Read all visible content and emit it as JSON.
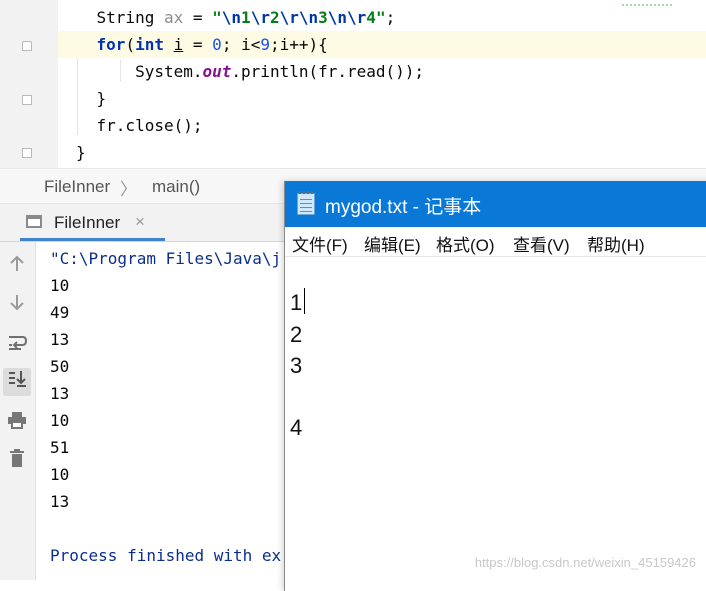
{
  "editor": {
    "line1": {
      "indent": "    ",
      "type": "String",
      "var": "ax",
      "op": " = ",
      "q1": "\"",
      "e1": "\\n",
      "v1": "1",
      "e2": "\\r",
      "v2": "2",
      "e3": "\\r",
      "e4": "\\n",
      "v3": "3",
      "e5": "\\n",
      "e6": "\\r",
      "v4": "4",
      "q2": "\"",
      "end": ";"
    },
    "line2": {
      "indent": "    ",
      "kw_for": "for",
      "p1": "(",
      "kw_int": "int",
      "sp": " ",
      "var_i": "i",
      "rest1": " = ",
      "zero": "0",
      "rest2": "; i<",
      "nine": "9",
      "rest3": ";i++){"
    },
    "line3": {
      "indent": "        ",
      "cls": "System.",
      "field": "out",
      "rest": ".println(fr.read());"
    },
    "line4": {
      "indent": "    ",
      "text": "}"
    },
    "line5": {
      "indent": "    ",
      "text": "fr.close();"
    },
    "line6": {
      "text": "}"
    }
  },
  "breadcrumb": {
    "class_name": "FileInner",
    "separator": "〉",
    "method": "main()"
  },
  "run_panel": {
    "tab_label": "FileInner",
    "tab_close": "×",
    "command_line": "\"C:\\Program Files\\Java\\j",
    "output": [
      "10",
      "49",
      "13",
      "50",
      "13",
      "10",
      "51",
      "10",
      "13"
    ],
    "finish_text": "Process finished with ex"
  },
  "toolbar_icons": [
    "arrow-up-icon",
    "arrow-down-icon",
    "soft-wrap-icon",
    "scroll-to-end-icon",
    "print-icon",
    "trash-icon"
  ],
  "notepad": {
    "title": "mygod.txt - 记事本",
    "menus": [
      "文件(F)",
      "编辑(E)",
      "格式(O)",
      "查看(V)",
      "帮助(H)"
    ],
    "lines": [
      "",
      "1",
      "2",
      "3",
      "",
      "4"
    ]
  },
  "watermark": "https://blog.csdn.net/weixin_45159426",
  "colors": {
    "accent": "#0a78d7",
    "tab_underline": "#4083c9",
    "keyword": "#0033b3",
    "string": "#067d17"
  }
}
